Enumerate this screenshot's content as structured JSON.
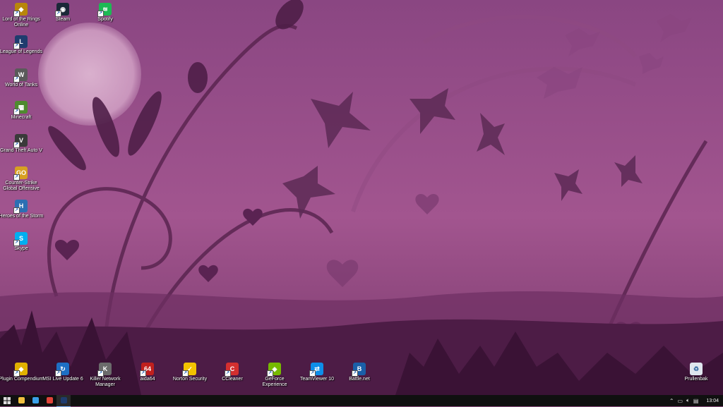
{
  "desktop_icons_left": [
    {
      "label": "Lord of the Rings Online",
      "icon": "lotro-icon",
      "color": "#b8860b",
      "glyph": "◆"
    },
    {
      "label": "League of Legends",
      "icon": "league-of-legends-icon",
      "color": "#1f3c6e",
      "glyph": "L"
    },
    {
      "label": "World of Tanks",
      "icon": "world-of-tanks-icon",
      "color": "#5a5a5a",
      "glyph": "W"
    },
    {
      "label": "Minecraft",
      "icon": "minecraft-icon",
      "color": "#4f8a2f",
      "glyph": "▦"
    },
    {
      "label": "Grand Theft Auto V",
      "icon": "gta-v-icon",
      "color": "#3a3a3a",
      "glyph": "V"
    },
    {
      "label": "Counter-Strike Global Offensive",
      "icon": "csgo-icon",
      "color": "#d7a021",
      "glyph": "GO"
    },
    {
      "label": "Heroes of the Storm",
      "icon": "heroes-of-the-storm-icon",
      "color": "#2c6fb3",
      "glyph": "H"
    },
    {
      "label": "Skype",
      "icon": "skype-icon",
      "color": "#00aff0",
      "glyph": "S"
    }
  ],
  "desktop_icons_top": [
    {
      "label": "Steam",
      "icon": "steam-icon",
      "color": "#1b2838",
      "glyph": "◉"
    },
    {
      "label": "Spotify",
      "icon": "spotify-icon",
      "color": "#1db954",
      "glyph": "≋"
    }
  ],
  "desktop_icons_bottom": [
    {
      "label": "Plugin Compendium",
      "icon": "plugin-compendium-icon",
      "color": "#e0b000",
      "glyph": "◆"
    },
    {
      "label": "MSI Live Update 6",
      "icon": "msi-live-update-icon",
      "color": "#1e6fc4",
      "glyph": "↻"
    },
    {
      "label": "Killer Network Manager",
      "icon": "killer-network-icon",
      "color": "#6b6b6b",
      "glyph": "K"
    },
    {
      "label": "aida64",
      "icon": "aida64-icon",
      "color": "#c0201e",
      "glyph": "64"
    },
    {
      "label": "Norton Security",
      "icon": "norton-icon",
      "color": "#f2c200",
      "glyph": "✓"
    },
    {
      "label": "CCleaner",
      "icon": "ccleaner-icon",
      "color": "#d32f2f",
      "glyph": "C"
    },
    {
      "label": "GeForce Experience",
      "icon": "geforce-icon",
      "color": "#76b900",
      "glyph": "◈"
    },
    {
      "label": "TeamViewer 10",
      "icon": "teamviewer-icon",
      "color": "#0e8ee9",
      "glyph": "⇄"
    },
    {
      "label": "Battle.net",
      "icon": "battlenet-icon",
      "color": "#1a5fa8",
      "glyph": "B"
    }
  ],
  "recycle_bin": {
    "label": "Prullenbak",
    "icon": "recycle-bin-icon"
  },
  "taskbar": {
    "start": "start-icon",
    "pinned": [
      {
        "icon": "file-explorer-icon",
        "color": "#f0c040"
      },
      {
        "icon": "browser-icon",
        "color": "#3aa0e8"
      },
      {
        "icon": "chrome-icon",
        "color": "#e0443a"
      },
      {
        "icon": "league-client-icon",
        "color": "#1f3c6e"
      }
    ],
    "tray": {
      "icons": [
        "chevron-up-icon",
        "network-icon",
        "volume-icon",
        "notification-icon"
      ],
      "time": "13:04"
    }
  }
}
